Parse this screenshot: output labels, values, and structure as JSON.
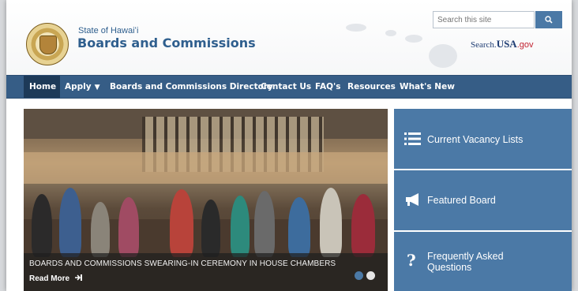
{
  "header": {
    "pre_title": "State of Hawaiʻi",
    "title": "Boards and Commissions",
    "search_placeholder": "Search this site",
    "search_button_icon": "search-icon",
    "usa_link": {
      "search": "Search.",
      "usa": "USA",
      "gov": ".gov"
    }
  },
  "nav": {
    "items": [
      {
        "label": "Home"
      },
      {
        "label": "Apply"
      },
      {
        "label": "Boards and Commissions Directory"
      },
      {
        "label": "Contact Us"
      },
      {
        "label": "FAQ's"
      },
      {
        "label": "Resources"
      },
      {
        "label": "What's New"
      }
    ]
  },
  "carousel": {
    "caption": "BOARDS AND COMMISSIONS SWEARING-IN CEREMONY IN HOUSE CHAMBERS",
    "read_more": "Read More",
    "read_more_icon": "arrow-right-circle-icon",
    "dots": 2,
    "active_dot": 1
  },
  "tiles": [
    {
      "label": "Current Vacancy Lists",
      "icon": "list-icon"
    },
    {
      "label": "Featured Board",
      "icon": "megaphone-icon"
    },
    {
      "label_line1": "Frequently Asked",
      "label_line2": "Questions",
      "icon": "question-icon"
    }
  ],
  "colors": {
    "nav_bg": "#365d86",
    "nav_active": "#1d3a58",
    "tile_bg": "#4b79a6",
    "title_color": "#2f5f8e"
  }
}
